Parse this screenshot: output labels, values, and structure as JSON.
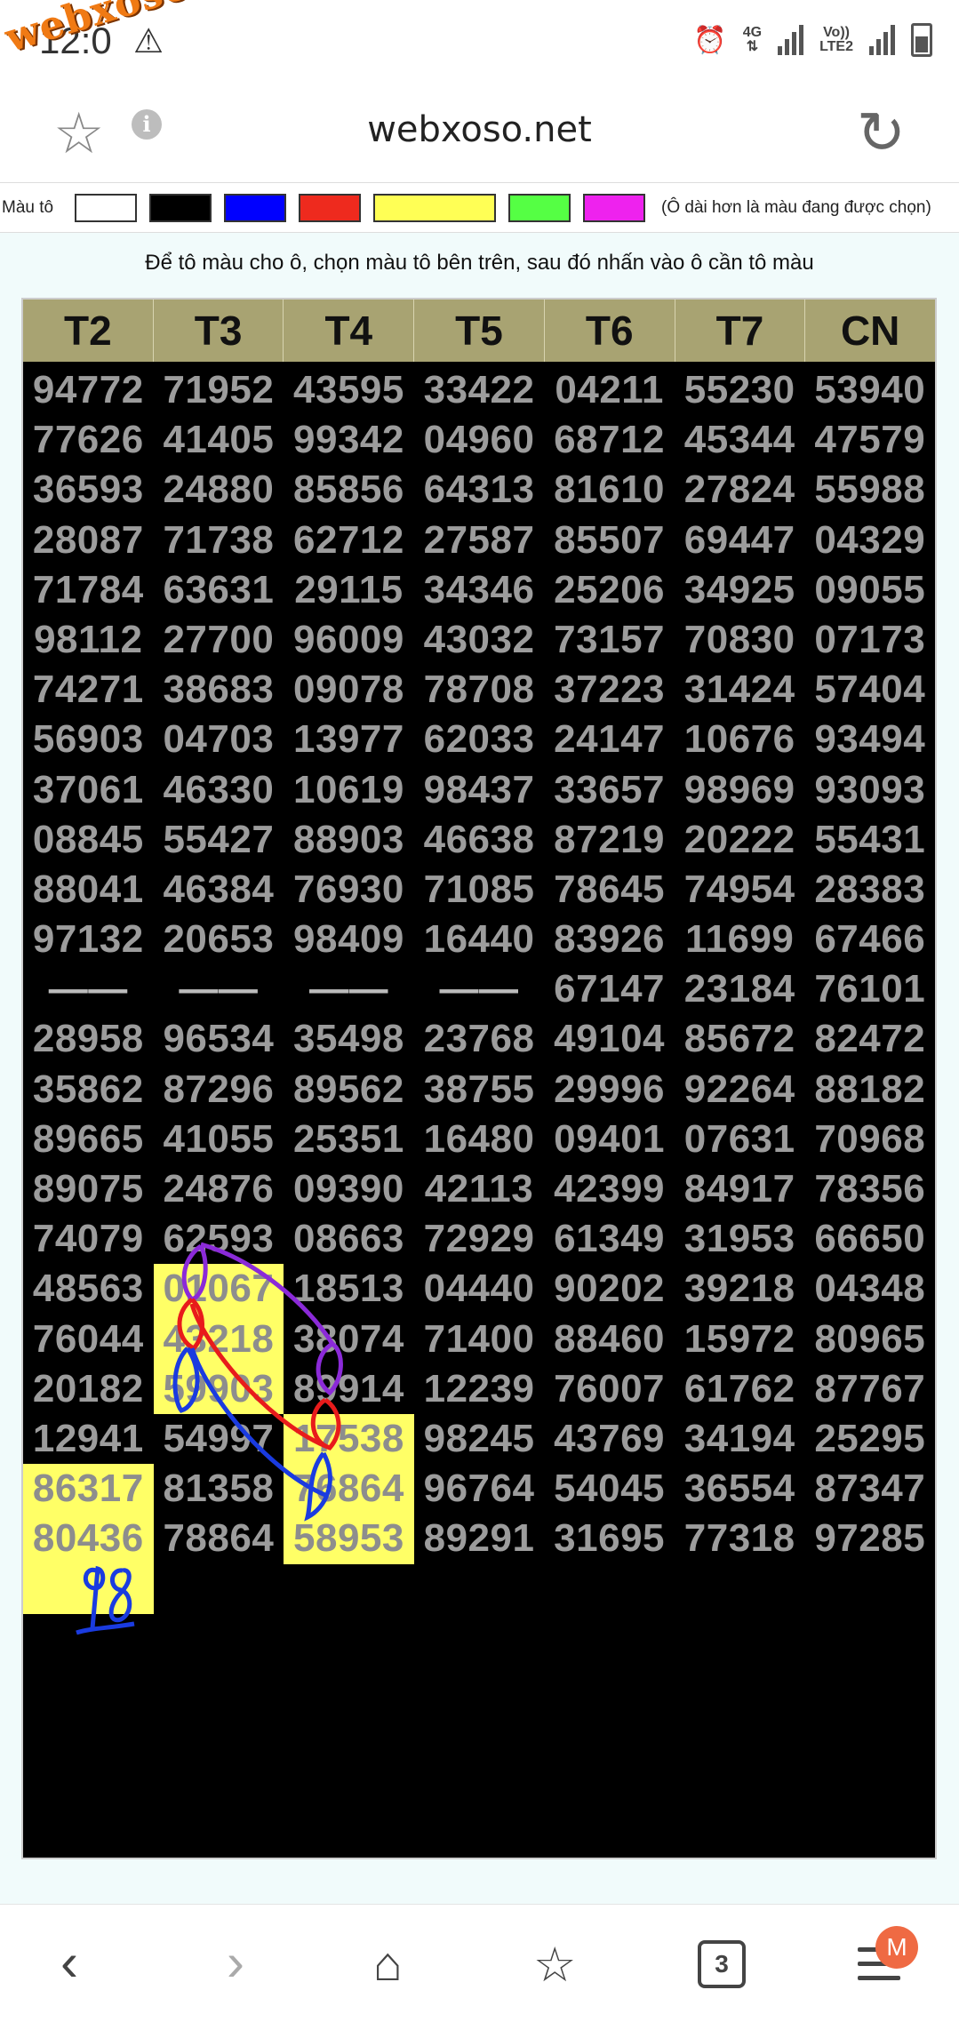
{
  "status": {
    "time": "12:0",
    "watermark": "webxoso.net",
    "network_top": "4G",
    "volte_line1": "Vo))",
    "volte_line2": "LTE2",
    "icons": [
      "warning-icon",
      "alarm-icon",
      "signal-icon",
      "battery-icon"
    ]
  },
  "browser": {
    "url": "webxoso.net",
    "info_glyph": "i"
  },
  "palette": {
    "label": "Màu tô",
    "colors": [
      "#ffffff",
      "#000000",
      "#0000ff",
      "#ee2a1e",
      "#ffff55",
      "#55ff44",
      "#ee22ee"
    ],
    "note": "(Ô dài hơn là màu đang được chọn)"
  },
  "instruction": "Để tô màu cho ô, chọn màu tô bên trên, sau đó nhấn vào ô cần tô màu",
  "table": {
    "headers": [
      "T2",
      "T3",
      "T4",
      "T5",
      "T6",
      "T7",
      "CN"
    ],
    "rows": [
      [
        "94772",
        "71952",
        "43595",
        "33422",
        "04211",
        "55230",
        "53940"
      ],
      [
        "77626",
        "41405",
        "99342",
        "04960",
        "68712",
        "45344",
        "47579"
      ],
      [
        "36593",
        "24880",
        "85856",
        "64313",
        "81610",
        "27824",
        "55988"
      ],
      [
        "28087",
        "71738",
        "62712",
        "27587",
        "85507",
        "69447",
        "04329"
      ],
      [
        "71784",
        "63631",
        "29115",
        "34346",
        "25206",
        "34925",
        "09055"
      ],
      [
        "98112",
        "27700",
        "96009",
        "43032",
        "73157",
        "70830",
        "07173"
      ],
      [
        "74271",
        "38683",
        "09078",
        "78708",
        "37223",
        "31424",
        "57404"
      ],
      [
        "56903",
        "04703",
        "13977",
        "62033",
        "24147",
        "10676",
        "93494"
      ],
      [
        "37061",
        "46330",
        "10619",
        "98437",
        "33657",
        "98969",
        "93093"
      ],
      [
        "08845",
        "55427",
        "88903",
        "46638",
        "87219",
        "20222",
        "55431"
      ],
      [
        "88041",
        "46384",
        "76930",
        "71085",
        "78645",
        "74954",
        "28383"
      ],
      [
        "97132",
        "20653",
        "98409",
        "16440",
        "83926",
        "11699",
        "67466"
      ],
      [
        "——",
        "——",
        "——",
        "——",
        "67147",
        "23184",
        "76101"
      ],
      [
        "28958",
        "96534",
        "35498",
        "23768",
        "49104",
        "85672",
        "82472"
      ],
      [
        "35862",
        "87296",
        "89562",
        "38755",
        "29996",
        "92264",
        "88182"
      ],
      [
        "89665",
        "41055",
        "25351",
        "16480",
        "09401",
        "07631",
        "70968"
      ],
      [
        "89075",
        "24876",
        "09390",
        "42113",
        "42399",
        "84917",
        "78356"
      ],
      [
        "74079",
        "62593",
        "08663",
        "72929",
        "61349",
        "31953",
        "66650"
      ],
      [
        "48563",
        "01067",
        "18513",
        "04440",
        "90202",
        "39218",
        "04348"
      ],
      [
        "76044",
        "43218",
        "38074",
        "71400",
        "88460",
        "15972",
        "80965"
      ],
      [
        "20182",
        "59903",
        "89914",
        "12239",
        "76007",
        "61762",
        "87767"
      ],
      [
        "12941",
        "54997",
        "17538",
        "98245",
        "43769",
        "34194",
        "25295"
      ],
      [
        "86317",
        "81358",
        "76864",
        "96764",
        "54045",
        "36554",
        "87347"
      ],
      [
        "80436",
        "78864",
        "58953",
        "89291",
        "31695",
        "77318",
        "97285"
      ],
      [
        "",
        "",
        "",
        "",
        "",
        "",
        ""
      ]
    ],
    "highlighted": [
      [
        18,
        1
      ],
      [
        19,
        1
      ],
      [
        20,
        1
      ],
      [
        21,
        2
      ],
      [
        22,
        2
      ],
      [
        23,
        2
      ],
      [
        22,
        0
      ],
      [
        23,
        0
      ],
      [
        24,
        0
      ]
    ],
    "highlight_color": "#ffff66",
    "handwritten_note": "98"
  },
  "bottom_nav": {
    "tab_count": "3",
    "profile_badge": "M",
    "icons": [
      "back-icon",
      "forward-icon",
      "home-icon",
      "bookmarks-icon",
      "tabs-icon",
      "menu-icon"
    ]
  }
}
